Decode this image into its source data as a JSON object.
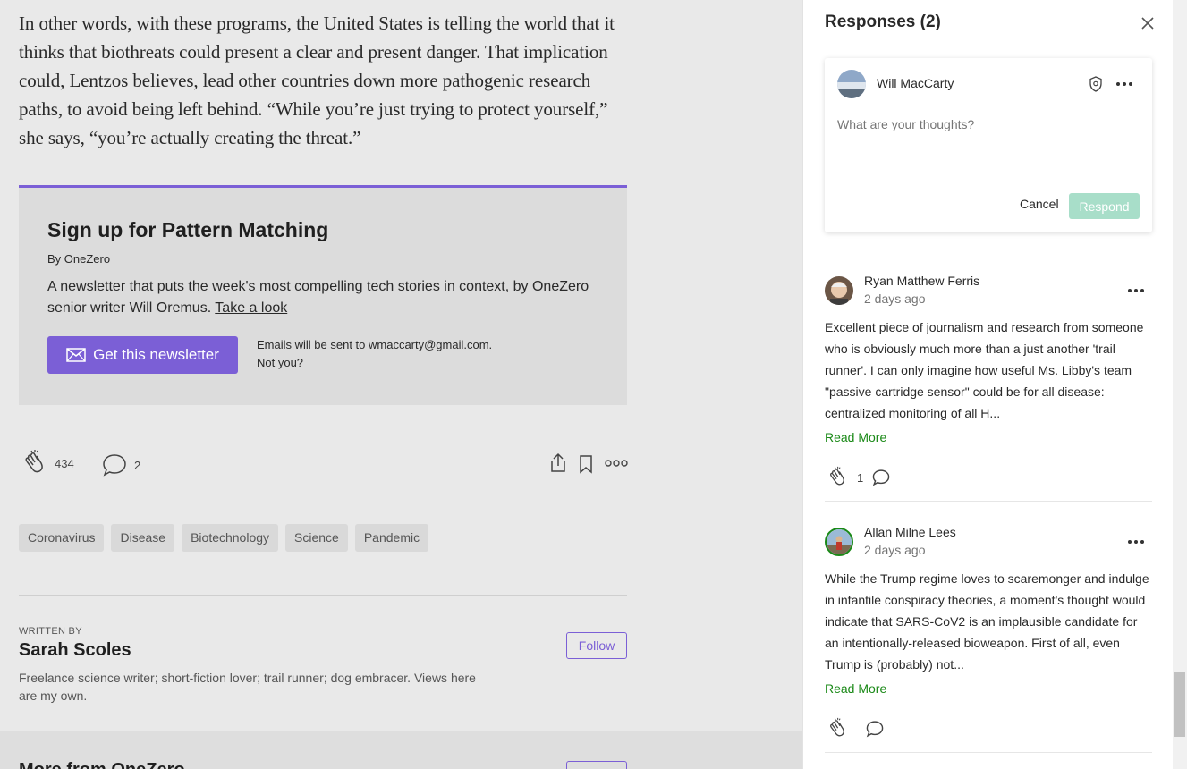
{
  "article": {
    "paragraph": "In other words, with these programs, the United States is telling the world that it thinks that biothreats could present a clear and present danger. That implication could, Lentzos believes, lead other countries down more pathogenic research paths, to avoid being left behind. “While you’re just trying to protect yourself,” she says, “you’re actually creating the threat.”"
  },
  "newsletter": {
    "title": "Sign up for Pattern Matching",
    "by": "By OneZero",
    "description": "A newsletter that puts the week's most compelling tech stories in context, by OneZero senior writer Will Oremus.",
    "link_text": "Take a look",
    "button_label": "Get this newsletter",
    "email_note": "Emails will be sent to wmaccarty@gmail.com.",
    "not_you": "Not you?"
  },
  "actions": {
    "claps": "434",
    "responses": "2"
  },
  "tags": [
    "Coronavirus",
    "Disease",
    "Biotechnology",
    "Science",
    "Pandemic"
  ],
  "author": {
    "written_by": "WRITTEN BY",
    "name": "Sarah Scoles",
    "bio": "Freelance science writer; short-fiction lover; trail runner; dog embracer. Views here are my own.",
    "follow_label": "Follow"
  },
  "more_from": {
    "title": "More from OneZero"
  },
  "panel": {
    "title": "Responses (2)",
    "compose": {
      "user": "Will MacCarty",
      "placeholder": "What are your thoughts?",
      "cancel": "Cancel",
      "respond": "Respond"
    },
    "responses": [
      {
        "name": "Ryan Matthew Ferris",
        "time": "2 days ago",
        "body": "Excellent piece of journalism and research from someone who is obviously much more than a just another 'trail runner'. I can only imagine how useful Ms. Libby's team \"passive cartridge sensor\" could be for all disease: centralized monitoring of all H...",
        "read_more": "Read More",
        "claps": "1"
      },
      {
        "name": "Allan Milne Lees",
        "time": "2 days ago",
        "body": "While the Trump regime loves to scaremonger and indulge in infantile conspiracy theories, a moment's thought would indicate that SARS-CoV2 is an implausible candidate for an intentionally-released bioweapon. First of all, even Trump is (probably) not...",
        "read_more": "Read More",
        "claps": ""
      }
    ]
  },
  "colors": {
    "accent_purple": "#7b5fd6",
    "respond_disabled": "#a8dec9",
    "read_more_green": "#1a8917"
  }
}
